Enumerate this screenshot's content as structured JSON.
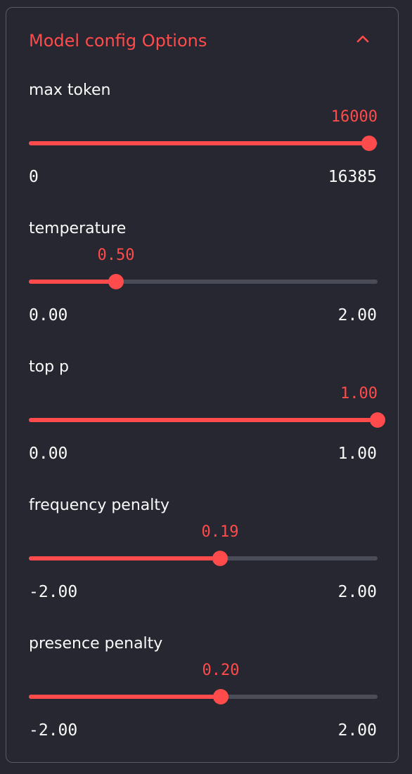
{
  "expander": {
    "title": "Model config Options",
    "expanded": true,
    "accent_color": "#ff4b4b",
    "toggle_icon": "chevron-up-icon"
  },
  "sliders": [
    {
      "label": "max token",
      "value": "16000",
      "min": "0",
      "max": "16385",
      "fraction": 0.9765
    },
    {
      "label": "temperature",
      "value": "0.50",
      "min": "0.00",
      "max": "2.00",
      "fraction": 0.25
    },
    {
      "label": "top p",
      "value": "1.00",
      "min": "0.00",
      "max": "1.00",
      "fraction": 1.0
    },
    {
      "label": "frequency penalty",
      "value": "0.19",
      "min": "-2.00",
      "max": "2.00",
      "fraction": 0.5475
    },
    {
      "label": "presence penalty",
      "value": "0.20",
      "min": "-2.00",
      "max": "2.00",
      "fraction": 0.55
    }
  ]
}
